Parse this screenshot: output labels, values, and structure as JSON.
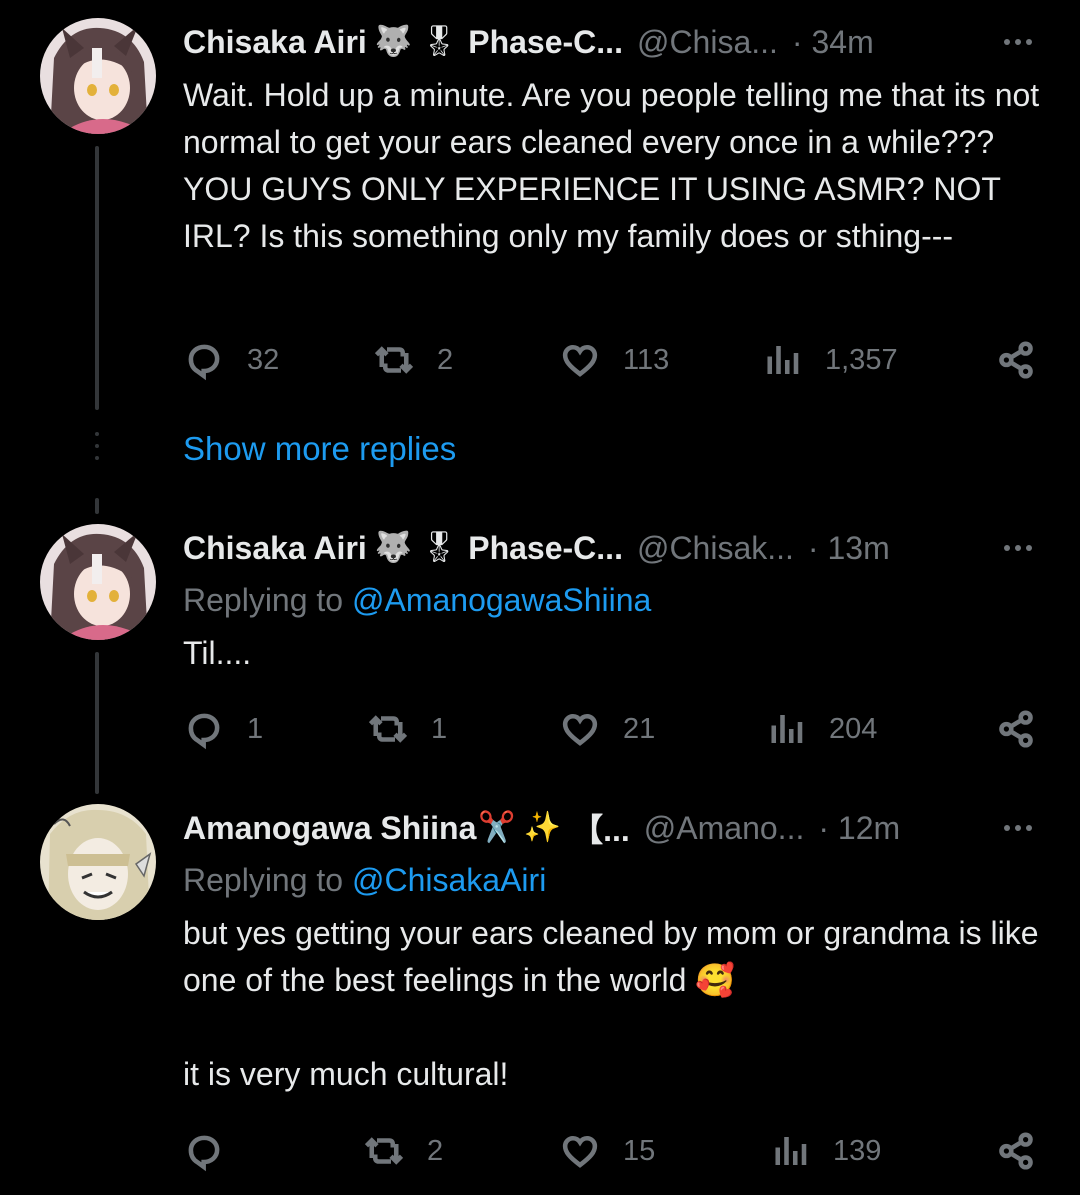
{
  "tweets": [
    {
      "name": "Chisaka Airi",
      "badges": [
        "🐺",
        "🎖"
      ],
      "affiliation": "Phase-C...",
      "handle": "@Chisa...",
      "time": "· 34m",
      "body": [
        "Wait. Hold up a minute. Are you people telling me that its not normal to get your ears cleaned every once in a while??? YOU GUYS ONLY EXPERIENCE IT USING ASMR? NOT IRL? Is this something only my family does or sthing---"
      ],
      "replies": "32",
      "retweets": "2",
      "likes": "113",
      "views": "1,357"
    },
    {
      "name": "Chisaka Airi",
      "badges": [
        "🐺",
        "🎖"
      ],
      "affiliation": "Phase-C...",
      "handle": "@Chisak...",
      "time": "· 13m",
      "replying_prefix": "Replying to ",
      "replying_to": "@AmanogawaShiina",
      "body": [
        "Til...."
      ],
      "replies": "1",
      "retweets": "1",
      "likes": "21",
      "views": "204"
    },
    {
      "name": "Amanogawa Shiina",
      "badges": [
        "✂️",
        "✨"
      ],
      "affiliation": "【...",
      "handle": "@Amano...",
      "time": "· 12m",
      "replying_prefix": "Replying to ",
      "replying_to": "@ChisakaAiri",
      "body": [
        "but yes getting your ears cleaned by mom or grandma is like one of the best feelings in the world 🥰",
        "it is very much cultural!"
      ],
      "replies": "",
      "retweets": "2",
      "likes": "15",
      "views": "139"
    }
  ],
  "show_more_replies": "Show more replies",
  "colors": {
    "background": "#000000",
    "text": "#e7e9ea",
    "secondary": "#71767b",
    "link": "#1d9bf0"
  },
  "icons": [
    "reply-icon",
    "retweet-icon",
    "like-icon",
    "views-icon",
    "share-icon",
    "more-icon"
  ]
}
